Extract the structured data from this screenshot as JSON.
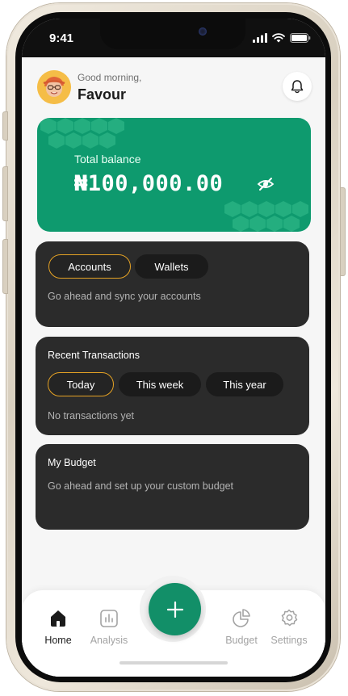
{
  "status_bar": {
    "time": "9:41"
  },
  "header": {
    "greeting": "Good morning,",
    "name": "Favour"
  },
  "balance": {
    "label": "Total balance",
    "amount": "₦100,000.00"
  },
  "accounts_card": {
    "tabs": [
      {
        "label": "Accounts",
        "active": true
      },
      {
        "label": "Wallets",
        "active": false
      }
    ],
    "message": "Go ahead and sync your accounts"
  },
  "transactions_card": {
    "title": "Recent Transactions",
    "filters": [
      {
        "label": "Today",
        "active": true
      },
      {
        "label": "This week",
        "active": false
      },
      {
        "label": "This year",
        "active": false
      }
    ],
    "empty_message": "No transactions yet"
  },
  "budget_card": {
    "title": "My Budget",
    "message": "Go ahead and set up your custom budget"
  },
  "bottom_nav": {
    "items": [
      {
        "label": "Home",
        "icon": "home-icon",
        "active": true
      },
      {
        "label": "Analysis",
        "icon": "analysis-icon",
        "active": false
      },
      {
        "label": "Budget",
        "icon": "pie-chart-icon",
        "active": false
      },
      {
        "label": "Settings",
        "icon": "gear-icon",
        "active": false
      }
    ],
    "fab_icon": "plus-icon"
  },
  "colors": {
    "brand_green": "#0e9a6e",
    "active_outline": "#e5a224",
    "card_dark": "#2b2b2b"
  }
}
